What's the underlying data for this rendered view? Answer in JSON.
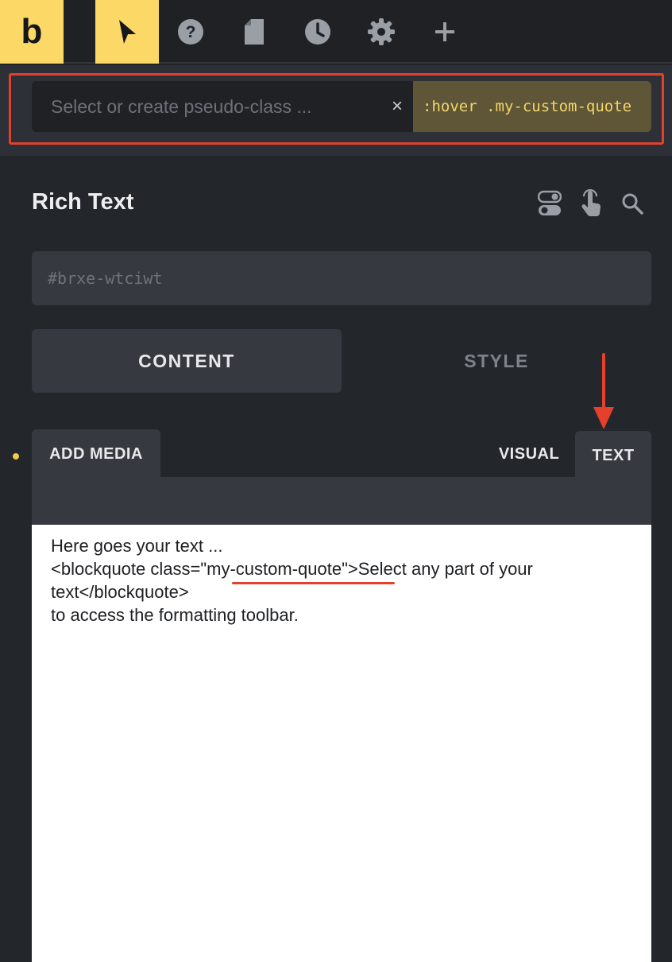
{
  "toolbar": {
    "logo_text": "b",
    "icons": [
      "select-pointer-icon",
      "help-icon",
      "page-icon",
      "history-icon",
      "settings-icon",
      "plus-icon"
    ]
  },
  "pseudo": {
    "placeholder": "Select or create pseudo-class ...",
    "clear_label": "×",
    "selector": ":hover .my-custom-quote"
  },
  "panel": {
    "title": "Rich Text",
    "element_id": "#brxe-wtciwt",
    "tabs": {
      "content": "CONTENT",
      "style": "STYLE"
    }
  },
  "editor": {
    "add_media": "ADD MEDIA",
    "mode_visual": "VISUAL",
    "mode_text": "TEXT",
    "lines": [
      "Here goes your text ...",
      "<blockquote class=\"my-custom-quote\">Select any part of your text</blockquote>",
      "to access the formatting toolbar."
    ]
  },
  "colors": {
    "accent": "#fcd866",
    "annotation": "#e4402b",
    "panel_bg": "#23262b",
    "control_bg": "#363940"
  }
}
